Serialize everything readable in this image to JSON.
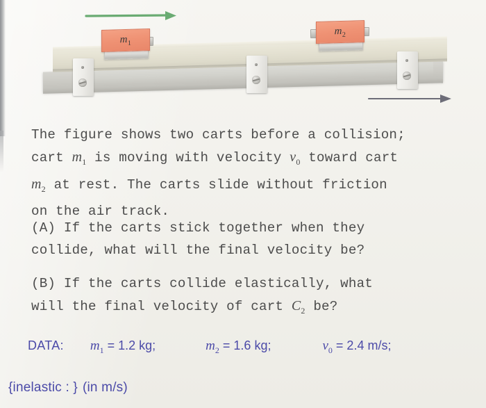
{
  "figure": {
    "caption_alt": "air track with two carts before a collision",
    "velocity_arrow": {
      "name": "green-velocity-arrow",
      "color": "#6aab72"
    },
    "direction_arrow": {
      "name": "grey-direction-arrow",
      "color": "#6d6d78"
    },
    "carts": [
      {
        "id": "cart-m1",
        "label": "m",
        "subscript": "1",
        "flag_color": "#ef9274"
      },
      {
        "id": "cart-m2",
        "label": "m",
        "subscript": "2",
        "flag_color": "#ef9274"
      }
    ],
    "track": {
      "rail_color": "#e6e3d4",
      "base_color": "#cbcac4",
      "support_count": 3
    }
  },
  "prose": {
    "intro_1": "The figure shows two carts before a collision;",
    "intro_2a": "cart ",
    "intro_2b": " is moving with velocity ",
    "intro_2c": " toward cart",
    "intro_3a": " at rest. The carts slide without friction",
    "intro_4": "on the air track.",
    "m1_sym": "m",
    "m1_sub": "1",
    "v0_sym": "v",
    "v0_sub": "0",
    "m2_sym": "m",
    "m2_sub": "2",
    "question_a_1": "(A) If the carts stick together when they",
    "question_a_2": "collide, what will the final velocity be?",
    "question_b_1": "(B) If the carts collide elastically, what",
    "question_b_2a": "will the final velocity of cart ",
    "question_b_2b": " be?",
    "c2_sym": "C",
    "c2_sub": "2"
  },
  "data": {
    "label": "DATA:",
    "color": "#4b4aa8",
    "items": [
      {
        "sym": "m",
        "sub": "1",
        "value": "= 1.2 kg;"
      },
      {
        "sym": "m",
        "sub": "2",
        "value": "= 1.6 kg;"
      },
      {
        "sym": "v",
        "sub": "0",
        "value": "= 2.4 m/s;"
      }
    ]
  },
  "answer": {
    "prompt": "{inelastic : }",
    "unit": "(in m/s)"
  }
}
